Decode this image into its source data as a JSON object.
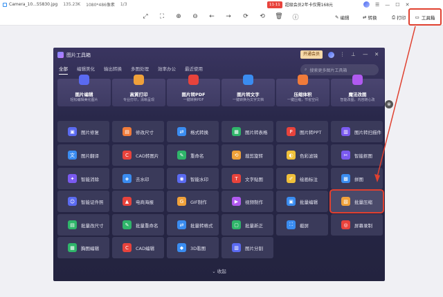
{
  "titlebar": {
    "filename": "Camera_10...55830.jpg",
    "filesize": "135.23K",
    "dimensions": "1080*486像素",
    "page": "1/3",
    "promo_tag": "11·11",
    "promo_text": "超级会员2年卡仅需168元",
    "window_controls": [
      "☰",
      "—",
      "☐",
      "✕"
    ]
  },
  "toolbar": {
    "edit_label": "编辑",
    "convert_label": "转换",
    "print_label": "打印",
    "toolbox_label": "工具箱",
    "icons": [
      "fit-icon",
      "actual-size-icon",
      "zoom-in-icon",
      "zoom-out-icon",
      "prev-icon",
      "next-icon",
      "rotate-icon",
      "delete-icon",
      "info-icon"
    ]
  },
  "dialog": {
    "title": "图片工具箱",
    "vip_label": "开通会员",
    "search_placeholder": "搜索更多图片工具箱",
    "tabs": [
      "全部",
      "编辑美化",
      "输出转换",
      "多图处理",
      "效率办公",
      "最近使用"
    ],
    "active_tab": 0,
    "cards": [
      {
        "title": "图片编辑",
        "sub": "轻松编辑美化图片",
        "color": "#5a6af0"
      },
      {
        "title": "高質打印",
        "sub": "专业打印，清晰呈现",
        "color": "#f0a13a"
      },
      {
        "title": "图片转PDF",
        "sub": "一键转换PDF",
        "color": "#e8433c"
      },
      {
        "title": "图片转文字",
        "sub": "一键转换为文字文档",
        "color": "#3a8cf0"
      },
      {
        "title": "压缩体积",
        "sub": "一键压缩，节省空间",
        "color": "#f07b3a"
      },
      {
        "title": "魔法改图",
        "sub": "智能改图，内容随心改",
        "color": "#b05af0"
      }
    ],
    "tools": [
      [
        {
          "label": "图片修复",
          "color": "#5a6af0",
          "icon": "▣"
        },
        {
          "label": "修改尺寸",
          "color": "#f07b3a",
          "icon": "▤"
        },
        {
          "label": "格式转换",
          "color": "#3a8cf0",
          "icon": "⇄"
        },
        {
          "label": "图片转表格",
          "color": "#2fb56a",
          "icon": "▦"
        },
        {
          "label": "图片转PPT",
          "color": "#e8433c",
          "icon": "P"
        },
        {
          "label": "图片转扫描件",
          "color": "#7a5af0",
          "icon": "▥"
        }
      ],
      [
        {
          "label": "图片翻译",
          "color": "#3a8cf0",
          "icon": "文"
        },
        {
          "label": "CAD转图片",
          "color": "#e8433c",
          "icon": "C"
        },
        {
          "label": "重命名",
          "color": "#2fb56a",
          "icon": "✎"
        },
        {
          "label": "裁剪旋转",
          "color": "#f0a13a",
          "icon": "⟲"
        },
        {
          "label": "色彩滤镜",
          "color": "#f0c03a",
          "icon": "◐"
        },
        {
          "label": "智能抠图",
          "color": "#7a5af0",
          "icon": "✂"
        }
      ],
      [
        {
          "label": "智能消除",
          "color": "#7a5af0",
          "icon": "✦"
        },
        {
          "label": "去水印",
          "color": "#3a8cf0",
          "icon": "◈"
        },
        {
          "label": "智能水印",
          "color": "#5a6af0",
          "icon": "◉"
        },
        {
          "label": "文字贴图",
          "color": "#e8433c",
          "icon": "T"
        },
        {
          "label": "绘画标注",
          "color": "#f0c03a",
          "icon": "✐"
        },
        {
          "label": "拼图",
          "color": "#3a8cf0",
          "icon": "▩"
        }
      ],
      [
        {
          "label": "智能证件照",
          "color": "#5a6af0",
          "icon": "☺"
        },
        {
          "label": "电商海报",
          "color": "#e8433c",
          "icon": "▲"
        },
        {
          "label": "GIF制作",
          "color": "#f0a13a",
          "icon": "G"
        },
        {
          "label": "视频制作",
          "color": "#b05af0",
          "icon": "▶"
        },
        {
          "label": "批量编辑",
          "color": "#3a8cf0",
          "icon": "▣"
        },
        {
          "label": "批量压缩",
          "color": "#f0a13a",
          "icon": "▧"
        }
      ],
      [
        {
          "label": "批量改尺寸",
          "color": "#2fb56a",
          "icon": "▤"
        },
        {
          "label": "批量重命名",
          "color": "#2fb56a",
          "icon": "✎"
        },
        {
          "label": "批量转格式",
          "color": "#3a8cf0",
          "icon": "⇄"
        },
        {
          "label": "批量新正",
          "color": "#2fb56a",
          "icon": "▢"
        },
        {
          "label": "截屏",
          "color": "#3a8cf0",
          "icon": "⛶"
        },
        {
          "label": "屏幕录制",
          "color": "#e8433c",
          "icon": "◎"
        }
      ],
      [
        {
          "label": "胸图编辑",
          "color": "#2fb56a",
          "icon": "▦"
        },
        {
          "label": "CAD编辑",
          "color": "#e8433c",
          "icon": "C"
        },
        {
          "label": "3D看图",
          "color": "#3a8cf0",
          "icon": "◆"
        },
        {
          "label": "图片分割",
          "color": "#5a6af0",
          "icon": "▥"
        }
      ]
    ],
    "highlighted_tool": "批量压缩",
    "collapse_label": "收起"
  },
  "colors": {
    "accent_red": "#e0402f",
    "dialog_bg": "#29284a",
    "tile_bg": "#3a3a5a"
  }
}
